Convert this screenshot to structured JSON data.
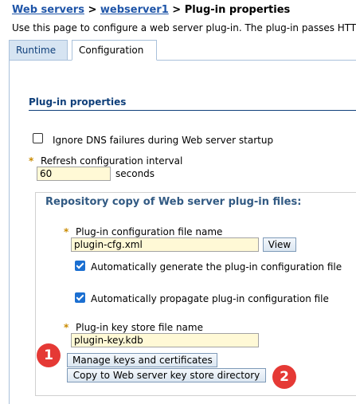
{
  "breadcrumb": {
    "link1": "Web servers",
    "sep1": " > ",
    "link2": "webserver1",
    "sep2": " > ",
    "current": "Plug-in properties"
  },
  "description": "Use this page to configure a web server plug-in. The plug-in passes HTT",
  "tabs": [
    {
      "label": "Runtime",
      "selected": false
    },
    {
      "label": "Configuration",
      "selected": true
    }
  ],
  "section": {
    "title": "Plug-in properties"
  },
  "ignore_dns": {
    "label": "Ignore DNS failures during Web server startup",
    "checked": false
  },
  "refresh": {
    "required_mark": "*",
    "label": "Refresh configuration interval",
    "value": "60",
    "unit": "seconds"
  },
  "repository": {
    "title": "Repository copy of Web server plug-in files:",
    "config_file": {
      "required_mark": "*",
      "label": "Plug-in configuration file name",
      "value": "plugin-cfg.xml",
      "view_button": "View"
    },
    "auto_generate": {
      "label": "Automatically generate the plug-in configuration file",
      "checked": true
    },
    "auto_propagate": {
      "label": "Automatically propagate plug-in configuration file",
      "checked": true
    },
    "key_store": {
      "required_mark": "*",
      "label": "Plug-in key store file name",
      "value": "plugin-key.kdb"
    },
    "manage_button": "Manage keys and certificates",
    "copy_button": "Copy to Web server key store directory"
  },
  "markers": [
    {
      "number": "1",
      "color": "#e53935"
    },
    {
      "number": "2",
      "color": "#e53935"
    }
  ]
}
